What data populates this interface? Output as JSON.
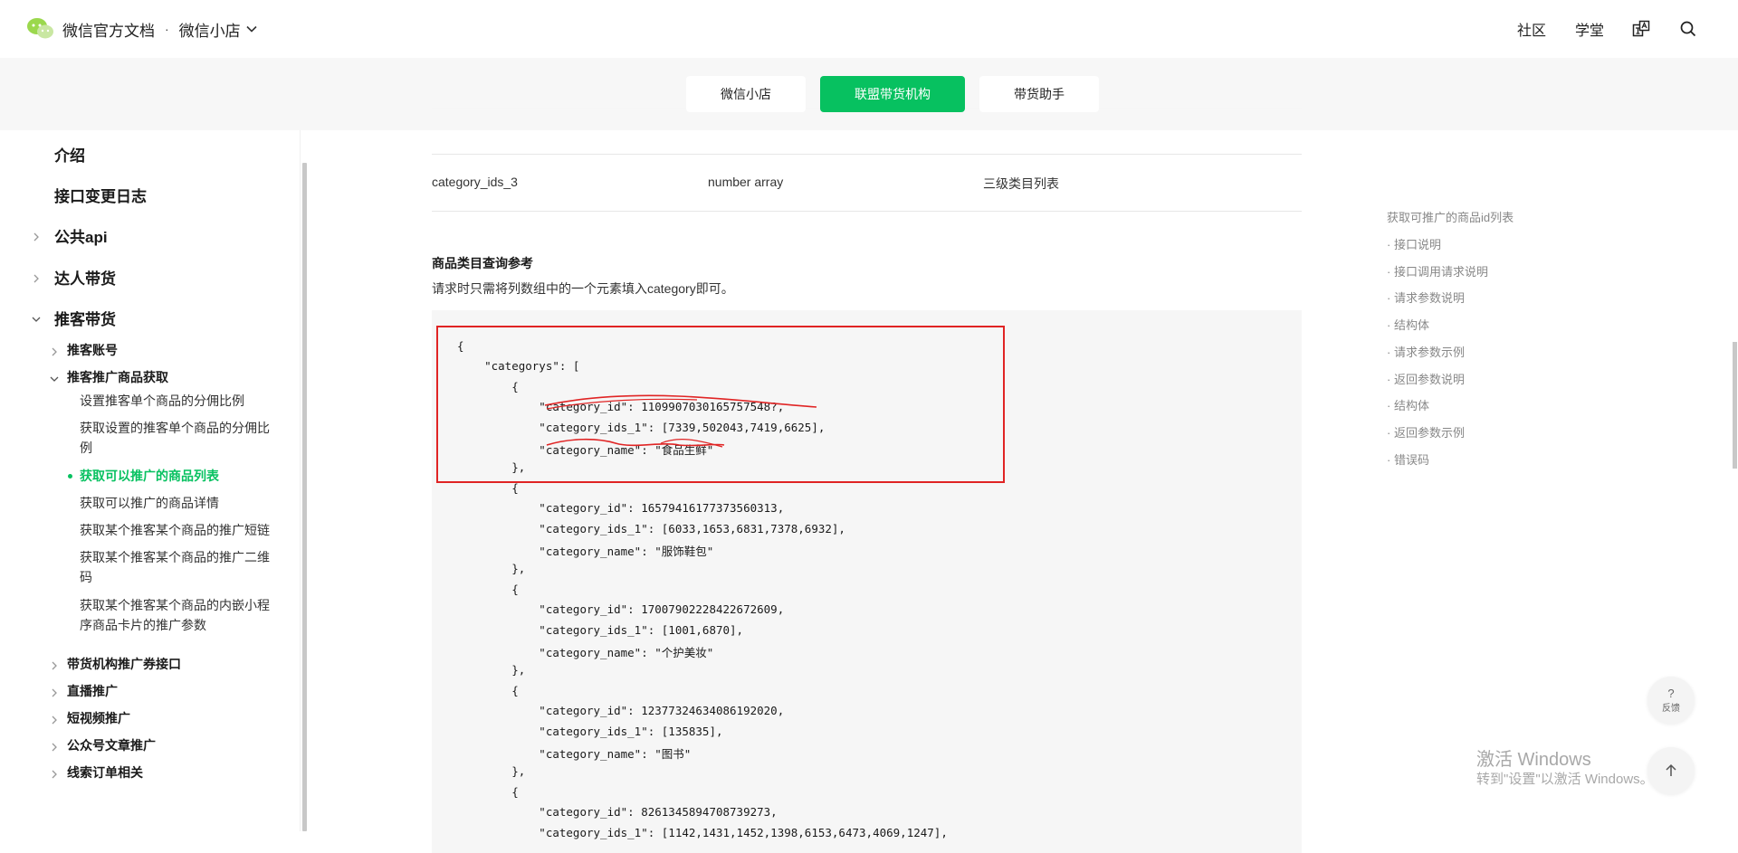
{
  "header": {
    "brand_title": "微信官方文档",
    "separator": "·",
    "product": "微信小店",
    "links": [
      "社区",
      "学堂"
    ],
    "icons": [
      "translate-icon",
      "search-icon"
    ]
  },
  "subnav": {
    "tabs": [
      {
        "label": "微信小店",
        "active": false
      },
      {
        "label": "联盟带货机构",
        "active": true
      },
      {
        "label": "带货助手",
        "active": false
      }
    ],
    "accent_color": "#07c160"
  },
  "sidebar": {
    "l1": [
      {
        "label": "介绍",
        "arrow": "none"
      },
      {
        "label": "接口变更日志",
        "arrow": "none"
      },
      {
        "label": "公共api",
        "arrow": "right"
      },
      {
        "label": "达人带货",
        "arrow": "right"
      },
      {
        "label": "推客带货",
        "arrow": "down"
      }
    ],
    "l2_top": [
      {
        "label": "推客账号",
        "arrow": "right"
      },
      {
        "label": "推客推广商品获取",
        "arrow": "down"
      }
    ],
    "l3": [
      "设置推客单个商品的分佣比例",
      "获取设置的推客单个商品的分佣比例",
      "获取可以推广的商品列表",
      "获取可以推广的商品详情",
      "获取某个推客某个商品的推广短链",
      "获取某个推客某个商品的推广二维码",
      "获取某个推客某个商品的内嵌小程序商品卡片的推广参数"
    ],
    "active_l3": "获取可以推广的商品列表",
    "l2_bottom": [
      {
        "label": "带货机构推广券接口",
        "arrow": "right"
      },
      {
        "label": "直播推广",
        "arrow": "right"
      },
      {
        "label": "短视频推广",
        "arrow": "right"
      },
      {
        "label": "公众号文章推广",
        "arrow": "right"
      },
      {
        "label": "线索订单相关",
        "arrow": "right"
      }
    ]
  },
  "main": {
    "table_row": {
      "field": "category_ids_3",
      "type": "number array",
      "desc": "三级类目列表"
    },
    "section_title": "商品类目查询参考",
    "section_desc": "请求时只需将列数组中的一个元素填入category即可。",
    "code_lines": [
      "{",
      "    \"categorys\": [",
      "        {",
      "            \"category_id\": 1109907030165757548?,",
      "            \"category_ids_1\": [7339,502043,7419,6625],",
      "            \"category_name\": \"食品生鲜\"",
      "        },",
      "        {",
      "            \"category_id\": 16579416177373560313,",
      "            \"category_ids_1\": [6033,1653,6831,7378,6932],",
      "            \"category_name\": \"服饰鞋包\"",
      "        },",
      "        {",
      "            \"category_id\": 17007902228422672609,",
      "            \"category_ids_1\": [1001,6870],",
      "            \"category_name\": \"个护美妆\"",
      "        },",
      "        {",
      "            \"category_id\": 12377324634086192020,",
      "            \"category_ids_1\": [135835],",
      "            \"category_name\": \"图书\"",
      "        },",
      "        {",
      "            \"category_id\": 8261345894708739273,",
      "            \"category_ids_1\": [1142,1431,1452,1398,6153,6473,4069,1247],"
    ],
    "annotation_color": "#e02424"
  },
  "toc": {
    "title": "获取可推广的商品id列表",
    "items": [
      "· 接口说明",
      "· 接口调用请求说明",
      "· 请求参数说明",
      "· 结构体",
      "· 请求参数示例",
      "· 返回参数说明",
      "· 结构体",
      "· 返回参数示例",
      "· 错误码"
    ]
  },
  "floating": {
    "feedback_symbol": "?",
    "feedback_label": "反馈",
    "top_icon": "arrow-up-icon"
  },
  "watermark": {
    "line1": "激活 Windows",
    "line2": "转到\"设置\"以激活 Windows。"
  }
}
